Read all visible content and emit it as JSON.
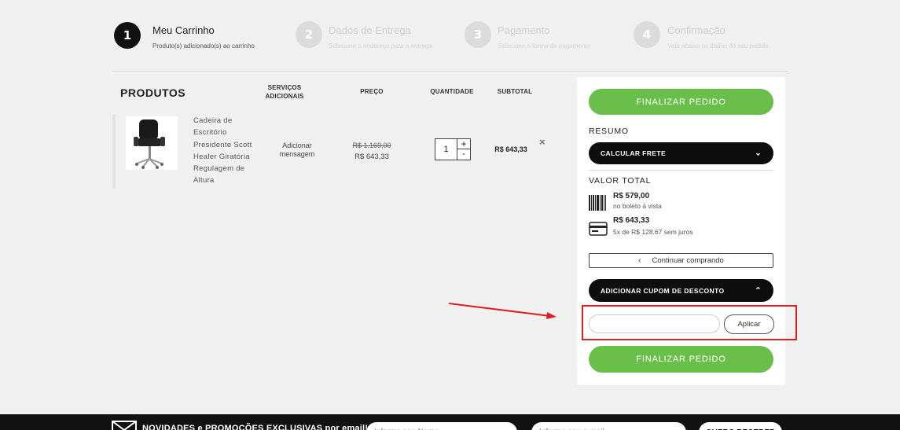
{
  "steps": [
    {
      "number": "1",
      "title": "Meu Carrinho",
      "subtitle": "Produto(s) adicionado(s) ao carrinho"
    },
    {
      "number": "2",
      "title": "Dados de Entrega",
      "subtitle": "Selecione o endereço para a entrega"
    },
    {
      "number": "3",
      "title": "Pagamento",
      "subtitle": "Selecione a forma de pagamento"
    },
    {
      "number": "4",
      "title": "Confirmação",
      "subtitle": "Veja abaixo os dados do seu pedido"
    }
  ],
  "table": {
    "heading": "PRODUTOS",
    "col_services_line1": "SERVIÇOS",
    "col_services_line2": "ADICIONAIS",
    "col_price": "PREÇO",
    "col_qty": "QUANTIDADE",
    "col_subtotal": "SUBTOTAL"
  },
  "product": {
    "name_lines": [
      "Cadeira de",
      "Escritório",
      "Presidente Scott",
      "Healer Giratória",
      "Regulagem de",
      "Altura"
    ],
    "service_line1": "Adicionar",
    "service_line2": "mensagem",
    "old_price": "R$ 1.169,00",
    "price": "R$ 643,33",
    "quantity": "1",
    "qty_plus": "+",
    "qty_minus": "-",
    "subtotal": "R$ 643,33",
    "remove": "×"
  },
  "summary": {
    "finalize_label": "FINALIZAR PEDIDO",
    "resumo_label": "RESUMO",
    "calc_frete_label": "CALCULAR FRETE",
    "valor_total_label": "VALOR TOTAL",
    "boleto_price": "R$ 579,00",
    "boleto_note": "no boleto à vista",
    "card_price": "R$ 643,33",
    "card_note": "5x de R$ 128,67 sem juros",
    "continue_label": "Continuar comprando",
    "coupon_label": "ADICIONAR CUPOM DE DESCONTO",
    "coupon_value": "",
    "apply_label": "Aplicar",
    "finalize_label_2": "FINALIZAR PEDIDO"
  },
  "footer": {
    "text": "NOVIDADES e PROMOÇÕES EXCLUSIVAS por email!",
    "name_placeholder": "Informe seu Nome",
    "email_placeholder": "Informe seu e-mail",
    "submit_label": "QUERO RECEBER"
  },
  "colors": {
    "green": "#6abf4b",
    "annotation_red": "#e02020",
    "black": "#0d0d0d"
  }
}
